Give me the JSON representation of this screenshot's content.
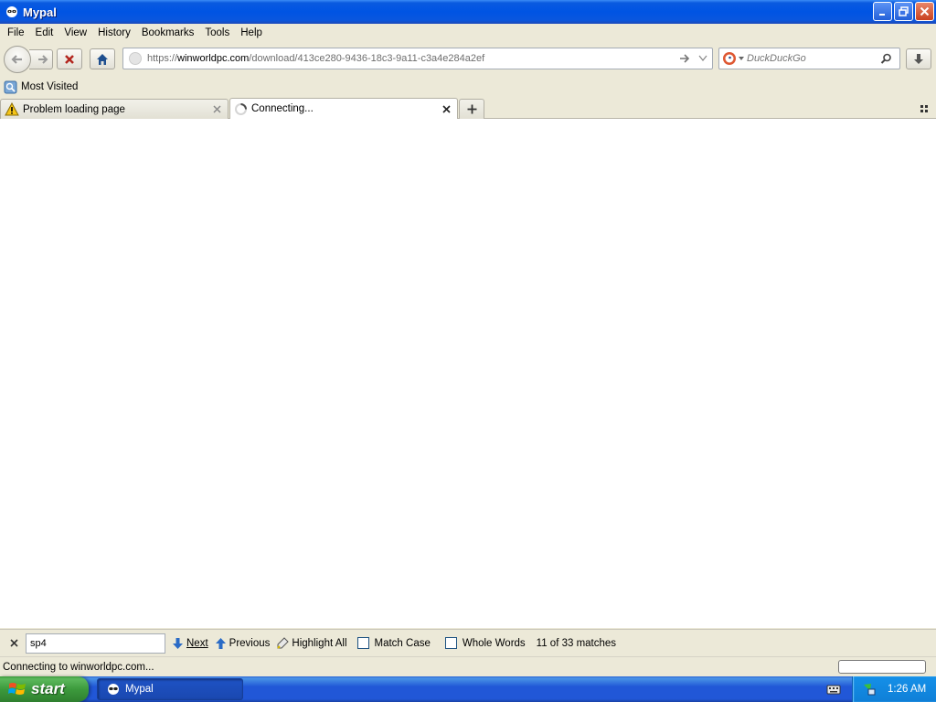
{
  "window": {
    "title": "Mypal",
    "icon": "mypal-raccoon-icon"
  },
  "menu": [
    "File",
    "Edit",
    "View",
    "History",
    "Bookmarks",
    "Tools",
    "Help"
  ],
  "nav": {
    "url_prefix": "https://",
    "url_host": "winworldpc.com",
    "url_path": "/download/413ce280-9436-18c3-9a11-c3a4e284a2ef",
    "search_placeholder": "DuckDuckGo"
  },
  "bookmarks": {
    "items": [
      {
        "label": "Most Visited"
      }
    ]
  },
  "tabs": [
    {
      "label": "Problem loading page",
      "icon": "warning-icon",
      "active": false
    },
    {
      "label": "Connecting...",
      "icon": "loading-icon",
      "active": true
    }
  ],
  "findbar": {
    "query": "sp4",
    "next_label": "Next",
    "previous_label": "Previous",
    "highlight_label": "Highlight All",
    "match_case_label": "Match Case",
    "whole_words_label": "Whole Words",
    "status": "11 of 33 matches"
  },
  "statusbar": {
    "text": "Connecting to winworldpc.com..."
  },
  "taskbar": {
    "start_label": "start",
    "task_label": "Mypal",
    "clock": "1:26 AM"
  },
  "colors": {
    "titlebar": "#0054e3",
    "chrome": "#ece9d8",
    "taskbar": "#2157d7",
    "start": "#3c9a3c",
    "tray": "#0f7fd7"
  }
}
